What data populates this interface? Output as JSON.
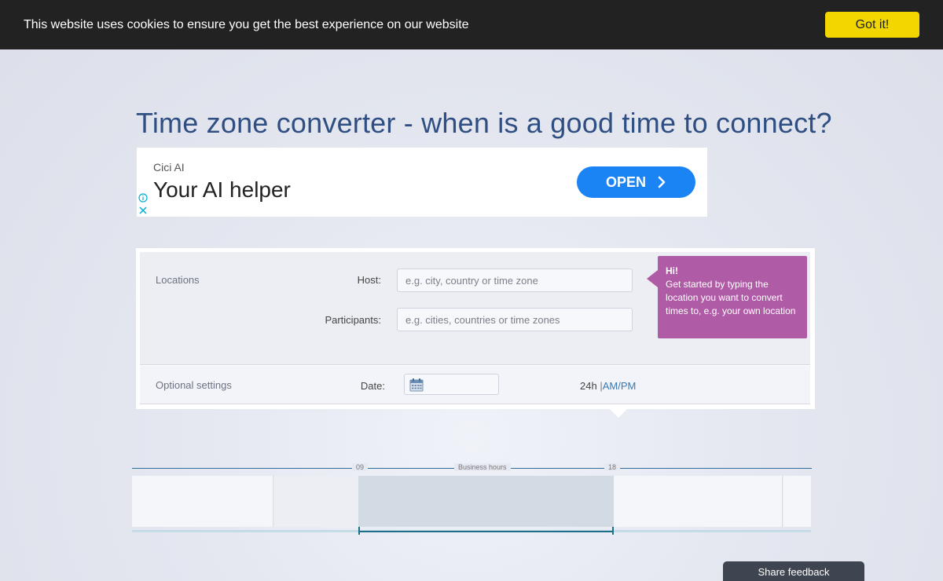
{
  "cookie_bar": {
    "message": "This website uses cookies to ensure you get the best experience on our website",
    "accept_label": "Got it!"
  },
  "page": {
    "title": "Time zone converter - when is a good time to connect?"
  },
  "ad": {
    "brand": "Cici AI",
    "headline": "Your AI helper",
    "cta_label": "OPEN"
  },
  "form": {
    "locations_label": "Locations",
    "host_label": "Host:",
    "host_placeholder": "e.g. city, country or time zone",
    "participants_label": "Participants:",
    "participants_placeholder": "e.g. cities, countries or time zones",
    "optional_label": "Optional settings",
    "date_label": "Date:",
    "format_24h": "24h",
    "format_separator": "|",
    "format_ampm": "AM/PM"
  },
  "tooltip": {
    "title": "Hi!",
    "body": "Get started by typing the location you want to convert times to, e.g. your own location"
  },
  "timeline": {
    "start_hour": "09",
    "end_hour": "18",
    "business_label": "Business hours"
  },
  "feedback": {
    "label": "Share feedback"
  },
  "colors": {
    "cookie_bg": "#222222",
    "cookie_button": "#f1d600",
    "title": "#2f4f83",
    "ad_button": "#1a84f5",
    "tooltip": "#b05ba6",
    "timeline_accent": "#1f6f8b"
  }
}
